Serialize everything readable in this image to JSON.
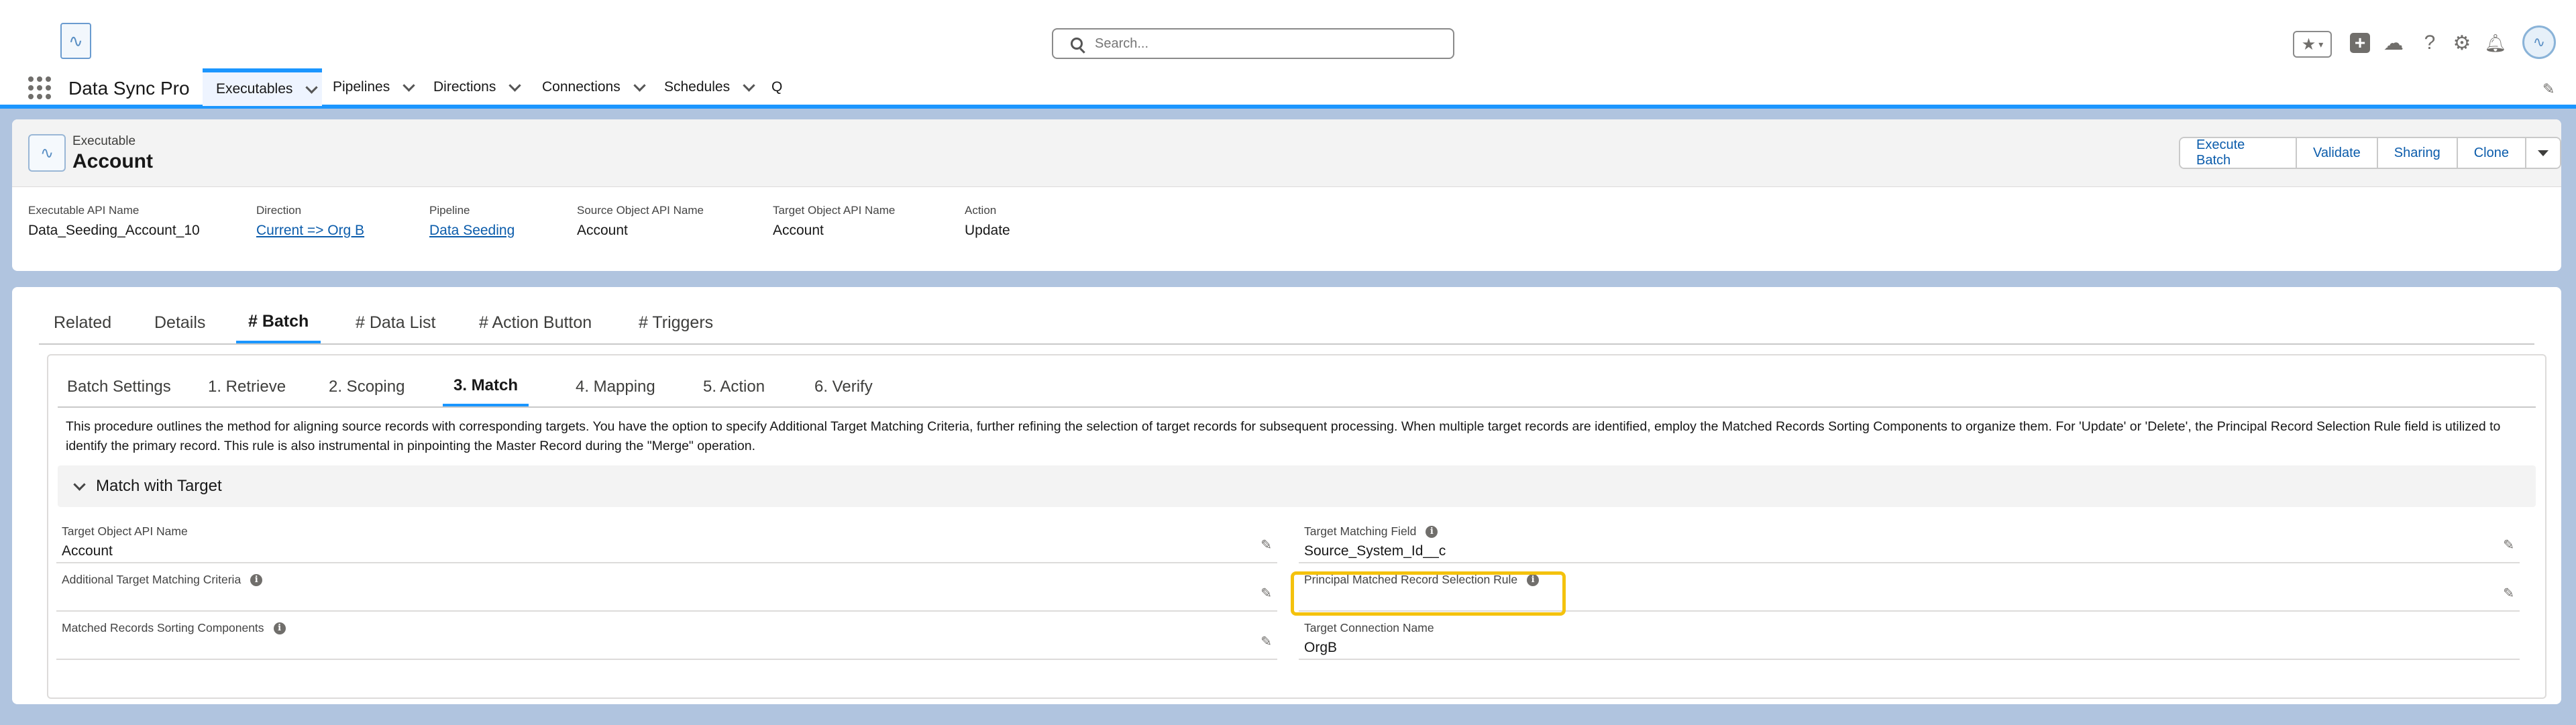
{
  "app": {
    "name": "Data Sync Pro",
    "search_placeholder": "Search..."
  },
  "nav": {
    "items": [
      {
        "label": "Executables"
      },
      {
        "label": "Pipelines"
      },
      {
        "label": "Directions"
      },
      {
        "label": "Connections"
      },
      {
        "label": "Schedules"
      },
      {
        "label": "Q"
      }
    ],
    "active": "Executables"
  },
  "record": {
    "type": "Executable",
    "name": "Account",
    "actions": [
      "Execute Batch",
      "Validate",
      "Sharing",
      "Clone"
    ],
    "fields": [
      {
        "label": "Executable API Name",
        "value": "Data_Seeding_Account_10"
      },
      {
        "label": "Direction",
        "value": "Current => Org B"
      },
      {
        "label": "Pipeline",
        "value": "Data Seeding"
      },
      {
        "label": "Source Object API Name",
        "value": "Account"
      },
      {
        "label": "Target Object API Name",
        "value": "Account"
      },
      {
        "label": "Action",
        "value": "Update"
      }
    ]
  },
  "tabs": {
    "main": [
      "Related",
      "Details",
      "# Batch",
      "# Data List",
      "# Action Button",
      "# Triggers"
    ],
    "main_active": "# Batch",
    "sub": [
      "Batch Settings",
      "1. Retrieve",
      "2. Scoping",
      "3. Match",
      "4. Mapping",
      "5. Action",
      "6. Verify"
    ],
    "sub_active": "3. Match"
  },
  "match": {
    "description_line1": "This procedure outlines the method for aligning source records with corresponding targets. You have the option to specify Additional Target Matching Criteria, further refining the selection of target records for subsequent processing. When multiple target records are identified, employ the Matched Records Sorting Components to organize them. For 'Update' or 'Delete', the Principal Record Selection Rule field is utilized to",
    "description_line2": "identify the primary record. This rule is also instrumental in pinpointing the Master Record during the \"Merge\" operation.",
    "section_title": "Match with Target",
    "fields": {
      "target_object_api_name": {
        "label": "Target Object API Name",
        "value": "Account"
      },
      "target_matching_field": {
        "label": "Target Matching Field",
        "value": "Source_System_Id__c"
      },
      "additional_target_matching_criteria": {
        "label": "Additional Target Matching Criteria",
        "value": ""
      },
      "principal_matched_record_selection_rule": {
        "label": "Principal Matched Record Selection Rule",
        "value": ""
      },
      "matched_records_sorting_components": {
        "label": "Matched Records Sorting Components",
        "value": ""
      },
      "target_connection_name": {
        "label": "Target Connection Name",
        "value": "OrgB"
      }
    }
  },
  "colors": {
    "brand_blue": "#1b96ff",
    "link_blue": "#0b5cab",
    "highlight_yellow": "#f4c20d",
    "page_background": "#b0c4df"
  }
}
